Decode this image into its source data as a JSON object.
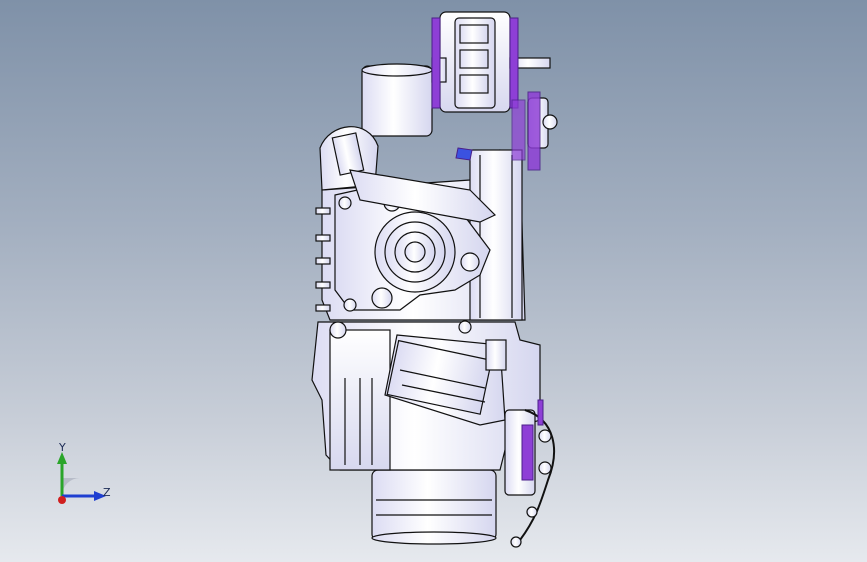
{
  "viewport": {
    "background_top": "#7f91a8",
    "background_bottom": "#e6e9ee",
    "model_description_icon": "engine-assembly-icon"
  },
  "triad": {
    "y_label": "Y",
    "z_label": "Z",
    "colors": {
      "y_axis": "#2aa52a",
      "z_axis": "#1f3fd1",
      "x_axis": "#d01f1f"
    }
  },
  "colors": {
    "part_fill": "#f2f3ff",
    "part_stroke": "#111111",
    "accent": "#8e3fd6",
    "shadow": "#c9cbe6"
  }
}
